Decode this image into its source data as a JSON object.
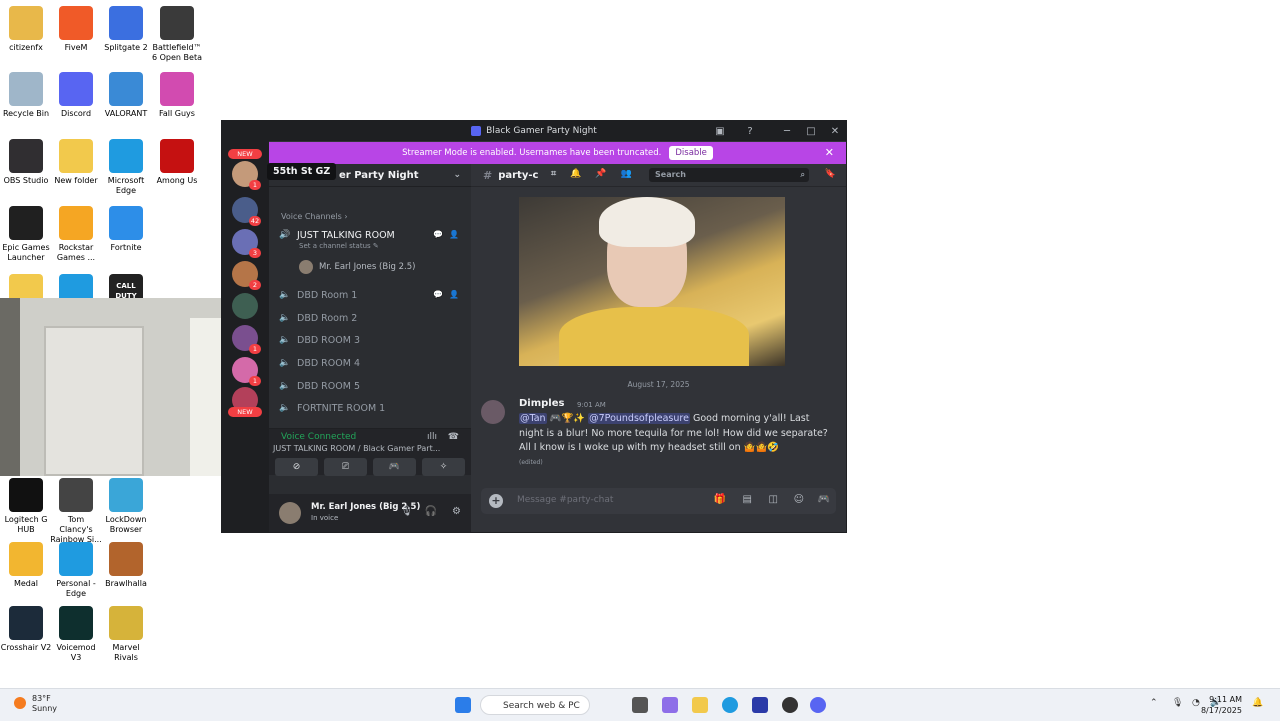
{
  "desktop": {
    "icons": [
      {
        "label": "citizenfx",
        "color": "#e8b84a"
      },
      {
        "label": "FiveM",
        "color": "#f05a28"
      },
      {
        "label": "Splitgate 2",
        "color": "#3b6fe0"
      },
      {
        "label": "Battlefield™ 6 Open Beta",
        "color": "#3a3a3a"
      },
      {
        "label": "Recycle Bin",
        "color": "#9fb6c9"
      },
      {
        "label": "Discord",
        "color": "#5865f2"
      },
      {
        "label": "VALORANT",
        "color": "#3a8ad6"
      },
      {
        "label": "Fall Guys",
        "color": "#d24bb0"
      },
      {
        "label": "OBS Studio",
        "color": "#302e31"
      },
      {
        "label": "New folder",
        "color": "#f2c94c"
      },
      {
        "label": "Microsoft Edge",
        "color": "#1f9be0"
      },
      {
        "label": "Among Us",
        "color": "#c51111"
      },
      {
        "label": "Epic Games Launcher",
        "color": "#202020"
      },
      {
        "label": "Rockstar Games ...",
        "color": "#f5a623"
      },
      {
        "label": "Fortnite",
        "color": "#2d8ee8"
      },
      {
        "label": "Logitech G HUB",
        "color": "#111111"
      },
      {
        "label": "Tom Clancy's Rainbow Si...",
        "color": "#444444"
      },
      {
        "label": "LockDown Browser",
        "color": "#3aa6d8"
      },
      {
        "label": "Medal",
        "color": "#f2b630"
      },
      {
        "label": "Personal - Edge",
        "color": "#1f9be0"
      },
      {
        "label": "Brawlhalla",
        "color": "#b2642c"
      },
      {
        "label": "Crosshair V2",
        "color": "#1c2b3a"
      },
      {
        "label": "Voicemod V3",
        "color": "#0e2f2e"
      },
      {
        "label": "Marvel Rivals",
        "color": "#d6b33a"
      }
    ],
    "partial_icon_labels": [
      "CALL DUTY"
    ]
  },
  "window": {
    "title": "Black Gamer Party Night",
    "banner_text": "Streamer Mode is enabled. Usernames have been truncated.",
    "banner_button": "Disable"
  },
  "guilds": {
    "new_label": "NEW",
    "badges": [
      "1",
      "42",
      "3",
      "2",
      "1",
      "1"
    ],
    "tooltip": "55th St GZ"
  },
  "channels": {
    "server_name": "er Party Night",
    "category": "Voice Channels",
    "list": [
      {
        "name": "JUST TALKING ROOM",
        "active": true
      },
      {
        "name": "DBD Room 1",
        "active": false
      },
      {
        "name": "DBD Room 2",
        "active": false
      },
      {
        "name": "DBD ROOM 3",
        "active": false
      },
      {
        "name": "DBD ROOM 4",
        "active": false
      },
      {
        "name": "DBD ROOM 5",
        "active": false
      },
      {
        "name": "FORTNITE ROOM 1",
        "active": false
      }
    ],
    "channel_status": "Set a channel status",
    "voice_user": "Mr. Earl Jones (Big 2.5)"
  },
  "voice": {
    "connected_label": "Voice Connected",
    "location": "JUST TALKING ROOM / Black Gamer Part..."
  },
  "user": {
    "name": "Mr. Earl Jones (Big 2.5)",
    "status": "In voice"
  },
  "chat": {
    "channel_name": "party-c",
    "search_placeholder": "Search",
    "date_separator": "August 17, 2025",
    "message": {
      "author": "Dimples",
      "time": "9:01 AM",
      "mention1": "@Tan",
      "mention2": "@7Poundsofpleasure",
      "text": "Good morning y'all! Last night is a blur! No more tequila for me lol! How did we separate? All I know is I woke up with my headset still on",
      "edited": "(edited)"
    },
    "composer_placeholder": "Message #party-chat"
  },
  "taskbar": {
    "temperature": "83°F",
    "weather": "Sunny",
    "search_text": "Search web & PC",
    "time": "9:11 AM",
    "date": "8/17/2025"
  }
}
